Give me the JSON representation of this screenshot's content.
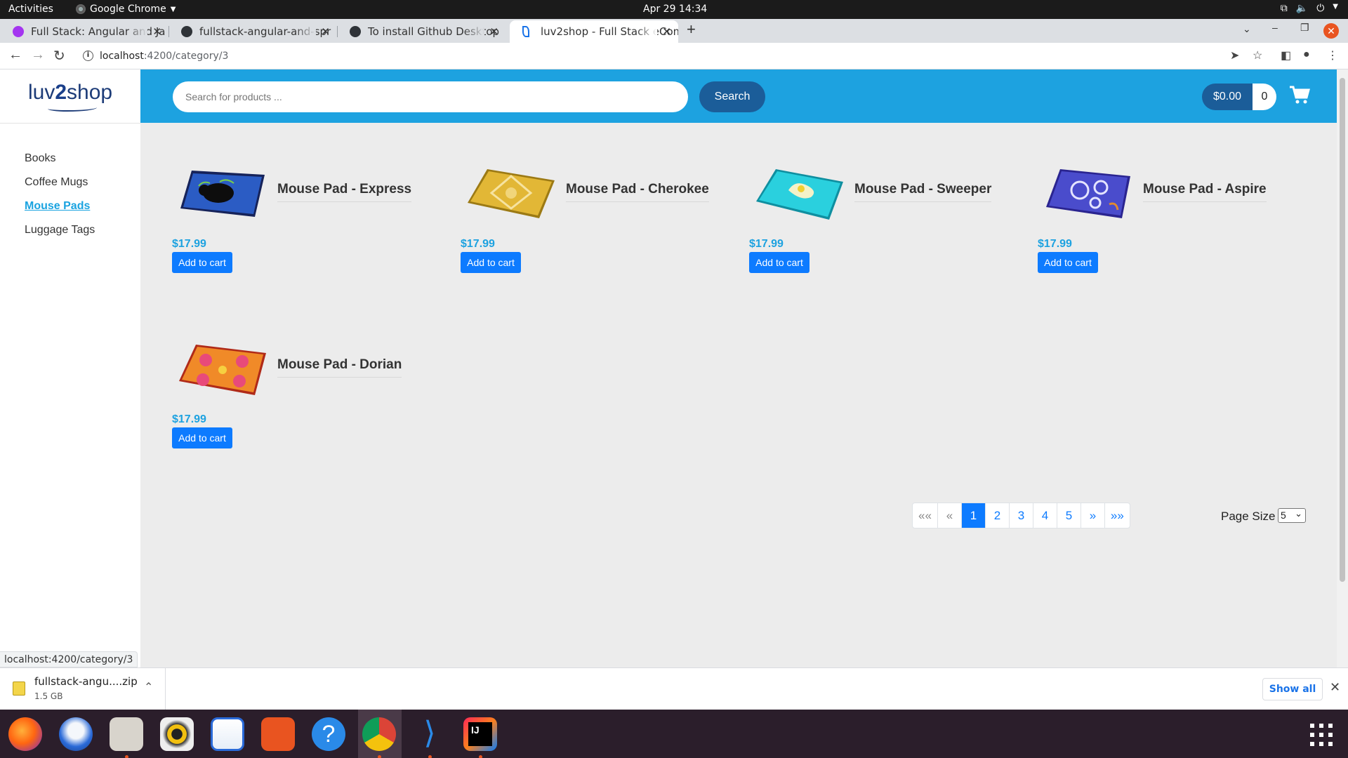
{
  "system_bar": {
    "activities": "Activities",
    "app_name": "Google Chrome",
    "datetime": "Apr 29  14:34"
  },
  "tabs": [
    {
      "title": "Full Stack: Angular and Ja",
      "favicon_color": "#a435f0"
    },
    {
      "title": "fullstack-angular-and-spr",
      "favicon_color": "#24292e"
    },
    {
      "title": "To install Github Desktop",
      "favicon_color": "#24292e"
    },
    {
      "title": "luv2shop - Full Stack eCom",
      "favicon_color": "#1a73e8",
      "active": true
    }
  ],
  "address_bar": {
    "host": "localhost",
    "path": ":4200/category/3"
  },
  "shop": {
    "logo_left": "luv",
    "logo_two": "2",
    "logo_right": "shop",
    "categories": [
      "Books",
      "Coffee Mugs",
      "Mouse Pads",
      "Luggage Tags"
    ],
    "active_category": "Mouse Pads",
    "search_placeholder": "Search for products ...",
    "search_button": "Search",
    "cart_total": "$0.00",
    "cart_quantity": "0",
    "add_to_cart_label": "Add to cart",
    "products": [
      {
        "name": "Mouse Pad - Express",
        "price": "$17.99",
        "image": "mouse-pad-express"
      },
      {
        "name": "Mouse Pad - Cherokee",
        "price": "$17.99",
        "image": "mouse-pad-cherokee"
      },
      {
        "name": "Mouse Pad - Sweeper",
        "price": "$17.99",
        "image": "mouse-pad-sweeper"
      },
      {
        "name": "Mouse Pad - Aspire",
        "price": "$17.99",
        "image": "mouse-pad-aspire"
      },
      {
        "name": "Mouse Pad - Dorian",
        "price": "$17.99",
        "image": "mouse-pad-dorian"
      }
    ],
    "pagination": {
      "first": "««",
      "prev": "«",
      "pages": [
        "1",
        "2",
        "3",
        "4",
        "5"
      ],
      "current_page": "1",
      "next": "»",
      "last": "»»",
      "page_size_label": "Page Size",
      "page_size_value": "5"
    },
    "accent_color": "#1da2e0",
    "button_color": "#0d7bff"
  },
  "status_url": "localhost:4200/category/3",
  "download_bar": {
    "file_name": "fullstack-angu....zip",
    "file_size": "1.5 GB",
    "show_all": "Show all"
  },
  "dock_apps": [
    "firefox-icon",
    "thunderbird-icon",
    "files-icon",
    "rhythmbox-icon",
    "writer-icon",
    "software-center-icon",
    "help-icon",
    "chrome-icon",
    "vscode-icon",
    "intellij-icon"
  ]
}
